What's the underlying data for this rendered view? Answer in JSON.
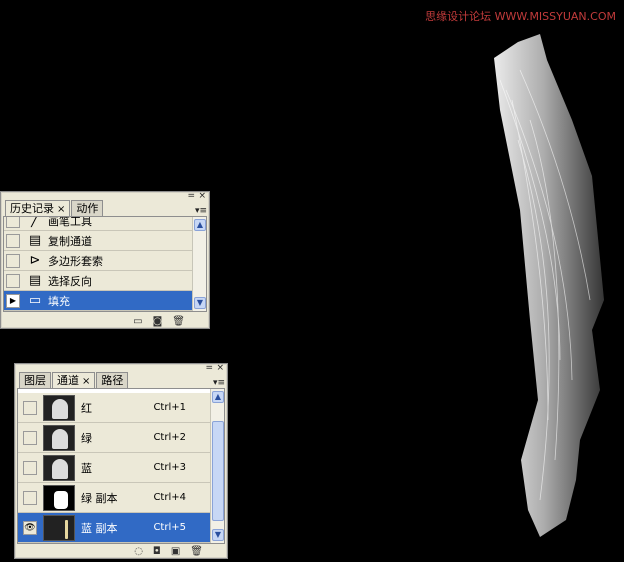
{
  "watermark": "思缘设计论坛 WWW.MISSYUAN.COM",
  "history_panel": {
    "tabs": [
      {
        "label": "历史记录",
        "close": "×",
        "active": true
      },
      {
        "label": "动作",
        "close": "",
        "active": false
      }
    ],
    "items": [
      {
        "label": "画笔工具",
        "icon": "brush-icon",
        "glyph": "╱",
        "selected": false
      },
      {
        "label": "复制通道",
        "icon": "document-icon",
        "glyph": "▤",
        "selected": false
      },
      {
        "label": "多边形套索",
        "icon": "polygon-lasso-icon",
        "glyph": "⊳",
        "selected": false
      },
      {
        "label": "选择反向",
        "icon": "document-icon",
        "glyph": "▤",
        "selected": false
      },
      {
        "label": "填充",
        "icon": "fill-icon",
        "glyph": "▭",
        "selected": true
      }
    ],
    "footer_icons": [
      "new-document-icon",
      "camera-icon",
      "trash-icon"
    ]
  },
  "channels_panel": {
    "tabs": [
      {
        "label": "图层",
        "close": "",
        "active": false
      },
      {
        "label": "通道",
        "close": "×",
        "active": true
      },
      {
        "label": "路径",
        "close": "",
        "active": false
      }
    ],
    "items": [
      {
        "name": "红",
        "shortcut": "Ctrl+1",
        "visible": false,
        "selected": false,
        "thumb": "gray"
      },
      {
        "name": "绿",
        "shortcut": "Ctrl+2",
        "visible": false,
        "selected": false,
        "thumb": "gray"
      },
      {
        "name": "蓝",
        "shortcut": "Ctrl+3",
        "visible": false,
        "selected": false,
        "thumb": "gray"
      },
      {
        "name": "绿 副本",
        "shortcut": "Ctrl+4",
        "visible": false,
        "selected": false,
        "thumb": "mask"
      },
      {
        "name": "蓝 副本",
        "shortcut": "Ctrl+5",
        "visible": true,
        "selected": true,
        "thumb": "dark"
      }
    ],
    "footer_icons": [
      "load-selection-icon",
      "save-selection-icon",
      "new-channel-icon",
      "trash-icon"
    ]
  },
  "panel_controls": {
    "minimize": "=",
    "close": "×",
    "menu": "▾≡"
  },
  "scroll_arrows": {
    "up": "▲",
    "down": "▼"
  },
  "eye_glyph": "👁",
  "footer_glyphs": {
    "new-document-icon": "▭",
    "camera-icon": "◙",
    "trash-icon": "🗑",
    "load-selection-icon": "◌",
    "save-selection-icon": "◘",
    "new-channel-icon": "▣"
  }
}
